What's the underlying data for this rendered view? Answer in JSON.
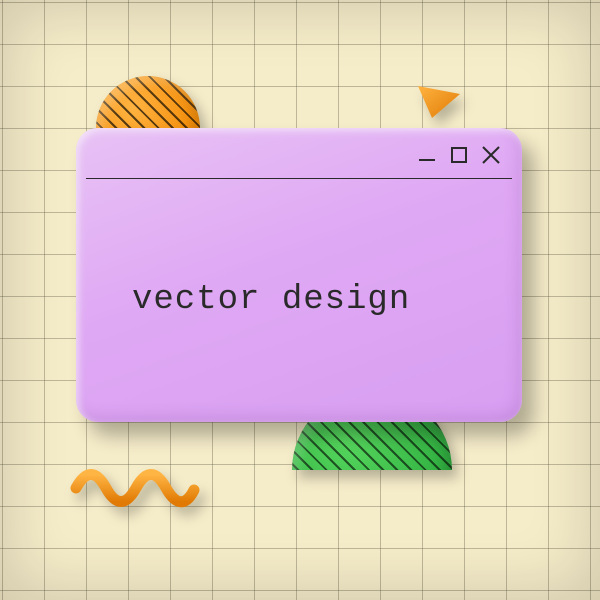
{
  "window": {
    "content_text": "vector design"
  }
}
